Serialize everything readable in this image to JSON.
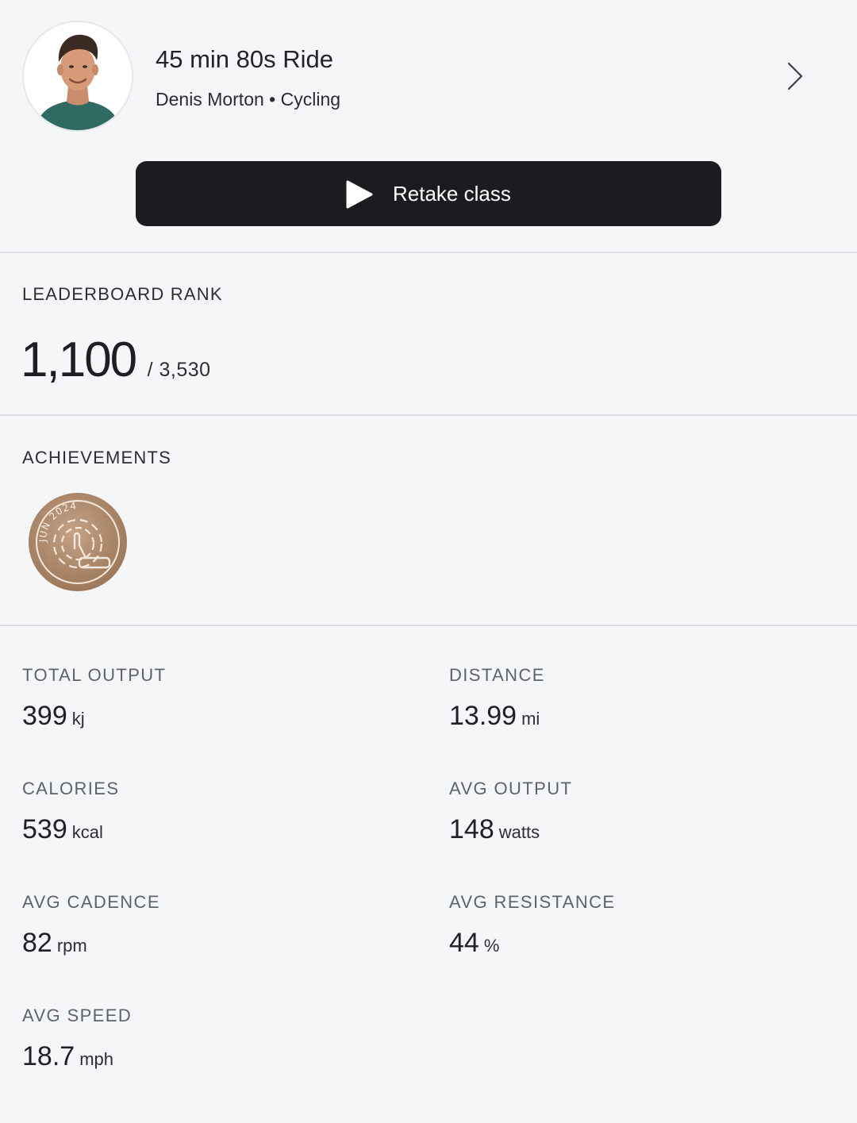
{
  "class": {
    "title": "45 min 80s Ride",
    "subtitle": "Denis Morton • Cycling",
    "avatar_icon": "instructor-avatar",
    "chevron_icon": "chevron-right-icon"
  },
  "retake": {
    "label": "Retake class",
    "icon": "play-icon"
  },
  "leaderboard": {
    "heading": "LEADERBOARD RANK",
    "rank": "1,100",
    "total": "/ 3,530"
  },
  "achievements": {
    "heading": "ACHIEVEMENTS",
    "badge": {
      "text": "JUN 2024",
      "icon": "monthly-challenge-badge",
      "color": "#a98466"
    }
  },
  "stats": [
    {
      "label": "TOTAL OUTPUT",
      "value": "399",
      "unit": "kj"
    },
    {
      "label": "DISTANCE",
      "value": "13.99",
      "unit": "mi"
    },
    {
      "label": "CALORIES",
      "value": "539",
      "unit": "kcal"
    },
    {
      "label": "AVG OUTPUT",
      "value": "148",
      "unit": "watts"
    },
    {
      "label": "AVG CADENCE",
      "value": "82",
      "unit": "rpm"
    },
    {
      "label": "AVG RESISTANCE",
      "value": "44",
      "unit": "%"
    },
    {
      "label": "AVG SPEED",
      "value": "18.7",
      "unit": "mph"
    }
  ],
  "colors": {
    "background": "#f5f6f8",
    "button": "#1b1c1f",
    "divider": "#dcdee2",
    "label": "#5d636c"
  }
}
